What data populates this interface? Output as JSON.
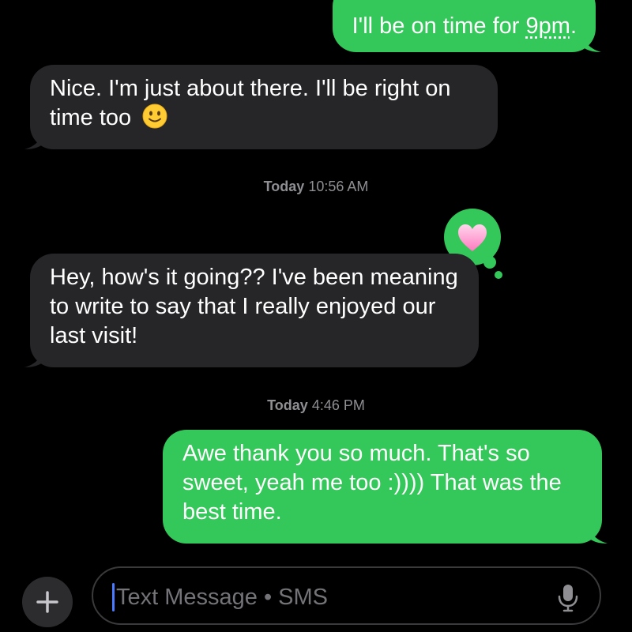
{
  "messages": [
    {
      "type": "sent",
      "text_before": "I'll be on time for ",
      "link": "9pm",
      "text_after": "."
    },
    {
      "type": "received",
      "text": "Nice. I'm just about there. I'll be right on time too",
      "emoji": "🙂"
    },
    {
      "type": "timestamp",
      "day": "Today",
      "time": "10:56 AM"
    },
    {
      "type": "received",
      "text": "Hey, how's it going?? I've been meaning to write to say that I really enjoyed our last visit!",
      "reaction": "heart"
    },
    {
      "type": "timestamp",
      "day": "Today",
      "time": "4:46 PM"
    },
    {
      "type": "sent",
      "text": "Awe thank you so much. That's so sweet, yeah me too :)))) That was the best time."
    }
  ],
  "input": {
    "placeholder": "Text Message • SMS",
    "plus_icon": "plus-icon",
    "mic_icon": "microphone-icon"
  },
  "colors": {
    "sent_bubble": "#34c759",
    "received_bubble": "#262629",
    "background": "#000000",
    "timestamp": "#8e8e93",
    "caret": "#4a7cff"
  }
}
